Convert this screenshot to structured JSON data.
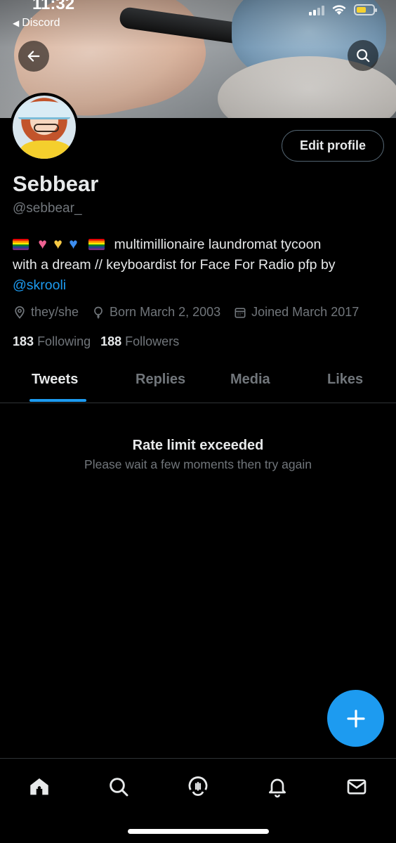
{
  "status_bar": {
    "time": "11:32",
    "back_app": "Discord"
  },
  "profile": {
    "name": "Sebbear",
    "handle": "@sebbear_",
    "edit_label": "Edit profile",
    "bio_line1": "multimillionaire laundromat tycoon",
    "bio_line2": "with a dream // keyboardist for Face For Radio pfp by",
    "bio_link": "@skrooli",
    "bio_emojis": [
      "rainbow-flag",
      "pink-heart",
      "yellow-heart",
      "blue-heart",
      "rainbow-flag"
    ],
    "pronouns": "they/she",
    "born": "Born March 2, 2003",
    "joined": "Joined March 2017",
    "following_count": "183",
    "following_label": "Following",
    "followers_count": "188",
    "followers_label": "Followers"
  },
  "tabs": [
    {
      "label": "Tweets",
      "active": true
    },
    {
      "label": "Replies",
      "active": false
    },
    {
      "label": "Media",
      "active": false
    },
    {
      "label": "Likes",
      "active": false
    }
  ],
  "message": {
    "title": "Rate limit exceeded",
    "subtitle": "Please wait a few moments then try again"
  },
  "bottom_nav": [
    "home-icon",
    "search-icon",
    "spaces-icon",
    "notifications-icon",
    "messages-icon"
  ],
  "colors": {
    "accent": "#1d9bf0",
    "muted": "#71767b",
    "text": "#e7e9ea",
    "background": "#000000"
  }
}
